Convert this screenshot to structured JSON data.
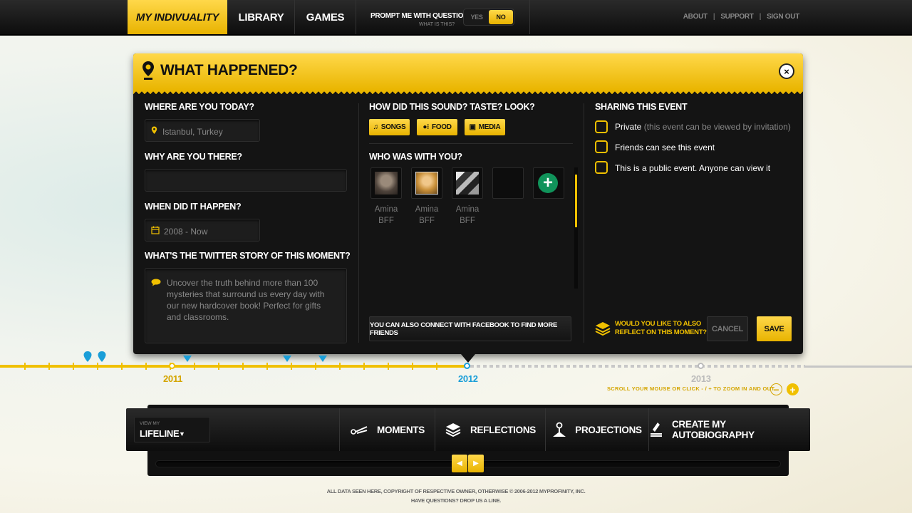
{
  "topbar": {
    "brand": "MY INDIVUALITY",
    "nav": [
      "LIBRARY",
      "GAMES"
    ],
    "prompt_label": "PROMPT ME WITH QUESTIONS",
    "prompt_help": "WHAT IS THIS?",
    "toggle_yes": "YES",
    "toggle_no": "NO",
    "links": [
      "ABOUT",
      "SUPPORT",
      "SIGN OUT"
    ]
  },
  "dialog": {
    "title": "WHAT HAPPENED?",
    "close": "×",
    "where_label": "WHERE ARE YOU TODAY?",
    "where_value": "Istanbul, Turkey",
    "why_label": "WHY ARE YOU THERE?",
    "why_value": "",
    "when_label": "WHEN DID IT HAPPEN?",
    "when_value": "2008 - Now",
    "twitter_label": "WHAT'S THE TWITTER STORY OF THIS MOMENT?",
    "twitter_value": "Uncover the truth behind more than 100 mysteries that surround us every day with our new hardcover book! Perfect for gifts and classrooms.",
    "media_label": "HOW DID THIS SOUND? TASTE? LOOK?",
    "media_buttons": [
      "SONGS",
      "FOOD",
      "MEDIA"
    ],
    "who_label": "WHO WAS WITH YOU?",
    "friends": [
      {
        "name": "Amina",
        "tag": "BFF"
      },
      {
        "name": "Amina",
        "tag": "BFF"
      },
      {
        "name": "Amina",
        "tag": "BFF"
      }
    ],
    "add_friend": "+",
    "facebook_button": "YOU CAN ALSO CONNECT WITH FACEBOOK TO FIND MORE FRIENDS",
    "sharing_label": "SHARING THIS EVENT",
    "sharing_options": [
      {
        "label": "Private",
        "note": "(this event can be viewed by invitation)"
      },
      {
        "label": "Friends can see this event",
        "note": ""
      },
      {
        "label": "This is a public event. Anyone can view it",
        "note": ""
      }
    ],
    "reflect_line1": "WOULD YOU LIKE TO  ALSO",
    "reflect_line2": "REFLECT ON THIS MOMENT?",
    "cancel": "CANCEL",
    "save": "SAVE"
  },
  "timeline": {
    "years": [
      "2011",
      "2012",
      "2013"
    ],
    "zoom_hint": "SCROLL YOUR MOUSE OR CLICK - / + TO ZOOM IN AND OUT",
    "zoom_out": "−",
    "zoom_in": "+",
    "colors": {
      "past": "#f0c000",
      "current": "#1a9ed8",
      "future": "#c8c8c8"
    }
  },
  "bottombar": {
    "view_small": "VIEW MY",
    "view_big": "LIFELINE",
    "nav": [
      "MOMENTS",
      "REFLECTIONS",
      "PROJECTIONS",
      "CREATE MY AUTOBIOGRAPHY"
    ],
    "prev": "◀",
    "next": "▶"
  },
  "footer": {
    "line1": "ALL DATA SEEN HERE, COPYRIGHT OF RESPECTIVE OWNER, OTHERWISE © 2006-2012 MYPROFINITY, INC.",
    "line2": "HAVE QUESTIONS? DROP US A LINE."
  }
}
